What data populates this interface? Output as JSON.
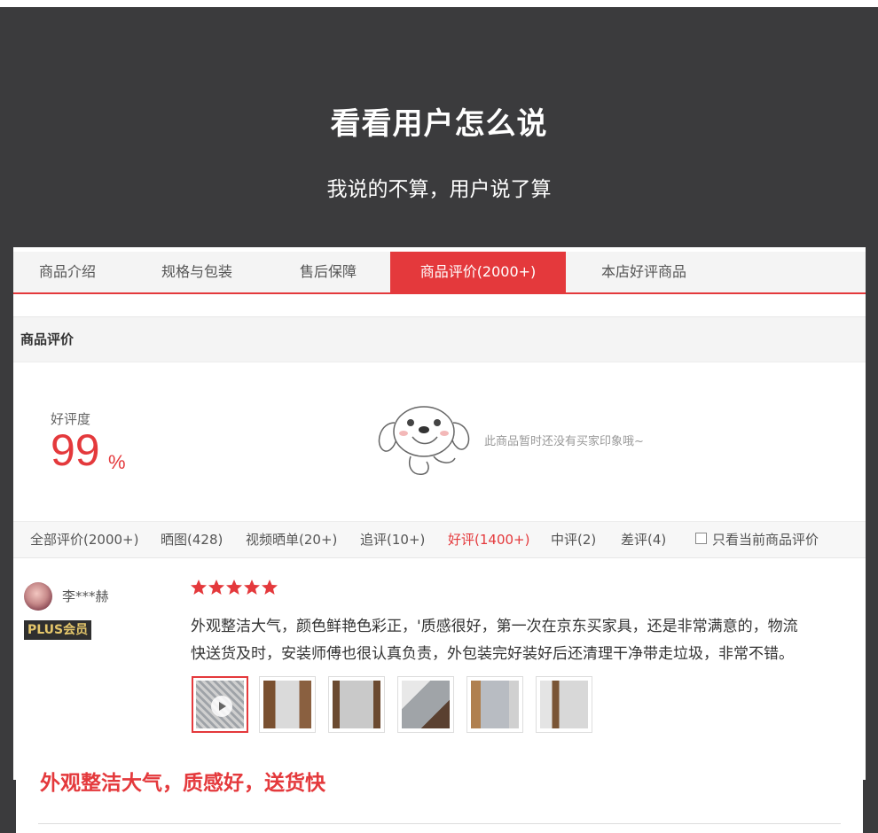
{
  "hero": {
    "title": "看看用户怎么说",
    "subtitle": "我说的不算，用户说了算"
  },
  "tabs": [
    {
      "label": "商品介绍"
    },
    {
      "label": "规格与包装"
    },
    {
      "label": "售后保障"
    },
    {
      "label": "商品评价(2000+)",
      "active": true
    },
    {
      "label": "本店好评商品"
    }
  ],
  "section_title": "商品评价",
  "rating": {
    "label": "好评度",
    "value": "99",
    "unit": "%"
  },
  "empty_text": "此商品暂时还没有买家印象哦~",
  "filters": [
    {
      "label": "全部评价(2000+)"
    },
    {
      "label": "晒图(428)"
    },
    {
      "label": "视频晒单(20+)"
    },
    {
      "label": "追评(10+)"
    },
    {
      "label": "好评(1400+)",
      "active": true
    },
    {
      "label": "中评(2)"
    },
    {
      "label": "差评(4)"
    }
  ],
  "only_current_label": "只看当前商品评价",
  "review": {
    "user": "李***赫",
    "badge": "PLUS会员",
    "stars": 5,
    "text_line1": "外观整洁大气，颜色鲜艳色彩正，'质感很好，第一次在京东买家具，还是非常满意的，物流",
    "text_line2": "快送货及时，安装师傅也很认真负责，外包装完好装好后还清理干净带走垃圾，非常不错。",
    "images": 6
  },
  "banner_text": "外观整洁大气，质感好，送货快",
  "colors": {
    "accent": "#e4393c",
    "dark": "#3b3b3d"
  }
}
